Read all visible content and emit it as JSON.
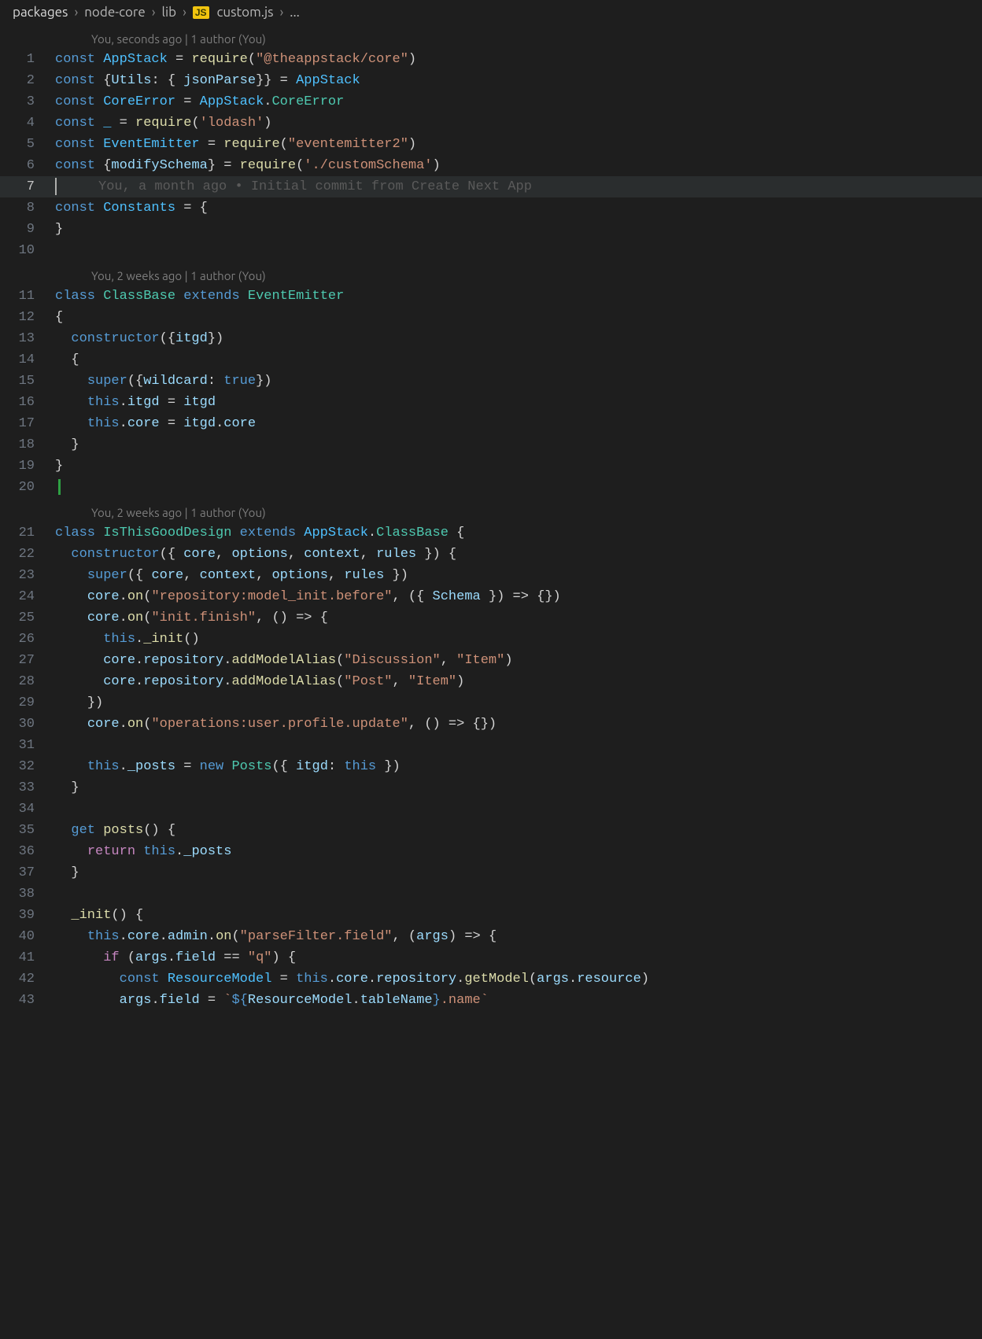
{
  "breadcrumb": {
    "seg1": "packages",
    "seg2": "node-core",
    "seg3": "lib",
    "seg4": "custom.js",
    "seg5": "...",
    "js_badge": "JS"
  },
  "codelens": {
    "block1": "You, seconds ago | 1 author (You)",
    "block2": "You, 2 weeks ago | 1 author (You)",
    "block3": "You, 2 weeks ago | 1 author (You)"
  },
  "blame": {
    "line7": "You, a month ago • Initial commit from Create Next App"
  },
  "line_numbers": [
    "1",
    "2",
    "3",
    "4",
    "5",
    "6",
    "7",
    "8",
    "9",
    "10",
    "11",
    "12",
    "13",
    "14",
    "15",
    "16",
    "17",
    "18",
    "19",
    "20",
    "21",
    "22",
    "23",
    "24",
    "25",
    "26",
    "27",
    "28",
    "29",
    "30",
    "31",
    "32",
    "33",
    "34",
    "35",
    "36",
    "37",
    "38",
    "39",
    "40",
    "41",
    "42",
    "43"
  ],
  "code": {
    "l1": {
      "a": "const",
      "b": "AppStack",
      "c": "=",
      "d": "require",
      "e": "(",
      "f": "\"@theappstack/core\"",
      "g": ")"
    },
    "l2": {
      "a": "const",
      "b": "{",
      "c": "Utils",
      "d": ": {",
      "e": "jsonParse",
      "f": "}} =",
      "g": "AppStack"
    },
    "l3": {
      "a": "const",
      "b": "CoreError",
      "c": "=",
      "d": "AppStack",
      "e": ".",
      "f": "CoreError"
    },
    "l4": {
      "a": "const",
      "b": "_",
      "c": "=",
      "d": "require",
      "e": "(",
      "f": "'lodash'",
      "g": ")"
    },
    "l5": {
      "a": "const",
      "b": "EventEmitter",
      "c": "=",
      "d": "require",
      "e": "(",
      "f": "\"eventemitter2\"",
      "g": ")"
    },
    "l6": {
      "a": "const",
      "b": "{",
      "c": "modifySchema",
      "d": "} =",
      "e": "require",
      "f": "(",
      "g": "'./customSchema'",
      "h": ")"
    },
    "l8": {
      "a": "const",
      "b": "Constants",
      "c": "= {"
    },
    "l9": {
      "a": "}"
    },
    "l11": {
      "a": "class",
      "b": "ClassBase",
      "c": "extends",
      "d": "EventEmitter"
    },
    "l12": {
      "a": "{"
    },
    "l13": {
      "a": "constructor",
      "b": "({",
      "c": "itgd",
      "d": "})"
    },
    "l14": {
      "a": "{"
    },
    "l15": {
      "a": "super",
      "b": "({",
      "c": "wildcard",
      "d": ":",
      "e": "true",
      "f": "})"
    },
    "l16": {
      "a": "this",
      "b": ".",
      "c": "itgd",
      "d": "=",
      "e": "itgd"
    },
    "l17": {
      "a": "this",
      "b": ".",
      "c": "core",
      "d": "=",
      "e": "itgd",
      "f": ".",
      "g": "core"
    },
    "l18": {
      "a": "}"
    },
    "l19": {
      "a": "}"
    },
    "l21": {
      "a": "class",
      "b": "IsThisGoodDesign",
      "c": "extends",
      "d": "AppStack",
      "e": ".",
      "f": "ClassBase",
      "g": "{"
    },
    "l22": {
      "a": "constructor",
      "b": "({",
      "c": "core",
      "d": ",",
      "e": "options",
      "f": ",",
      "g": "context",
      "h": ",",
      "i": "rules",
      "j": "}) {"
    },
    "l23": {
      "a": "super",
      "b": "({",
      "c": "core",
      "d": ",",
      "e": "context",
      "f": ",",
      "g": "options",
      "h": ",",
      "i": "rules",
      "j": "})"
    },
    "l24": {
      "a": "core",
      "b": ".",
      "c": "on",
      "d": "(",
      "e": "\"repository:model_init.before\"",
      "f": ", ({",
      "g": "Schema",
      "h": "}) => {})"
    },
    "l25": {
      "a": "core",
      "b": ".",
      "c": "on",
      "d": "(",
      "e": "\"init.finish\"",
      "f": ", () => {"
    },
    "l26": {
      "a": "this",
      "b": ".",
      "c": "_init",
      "d": "()"
    },
    "l27": {
      "a": "core",
      "b": ".",
      "c": "repository",
      "d": ".",
      "e": "addModelAlias",
      "f": "(",
      "g": "\"Discussion\"",
      "h": ",",
      "i": "\"Item\"",
      "j": ")"
    },
    "l28": {
      "a": "core",
      "b": ".",
      "c": "repository",
      "d": ".",
      "e": "addModelAlias",
      "f": "(",
      "g": "\"Post\"",
      "h": ",",
      "i": "\"Item\"",
      "j": ")"
    },
    "l29": {
      "a": "})"
    },
    "l30": {
      "a": "core",
      "b": ".",
      "c": "on",
      "d": "(",
      "e": "\"operations:user.profile.update\"",
      "f": ", () => {})"
    },
    "l32": {
      "a": "this",
      "b": ".",
      "c": "_posts",
      "d": "=",
      "e": "new",
      "f": "Posts",
      "g": "({",
      "h": "itgd",
      "i": ":",
      "j": "this",
      "k": "})"
    },
    "l33": {
      "a": "}"
    },
    "l35": {
      "a": "get",
      "b": "posts",
      "c": "() {"
    },
    "l36": {
      "a": "return",
      "b": "this",
      "c": ".",
      "d": "_posts"
    },
    "l37": {
      "a": "}"
    },
    "l39": {
      "a": "_init",
      "b": "() {"
    },
    "l40": {
      "a": "this",
      "b": ".",
      "c": "core",
      "d": ".",
      "e": "admin",
      "f": ".",
      "g": "on",
      "h": "(",
      "i": "\"parseFilter.field\"",
      "j": ", (",
      "k": "args",
      "l": ") => {"
    },
    "l41": {
      "a": "if",
      "b": "(",
      "c": "args",
      "d": ".",
      "e": "field",
      "f": "==",
      "g": "\"q\"",
      "h": ") {"
    },
    "l42": {
      "a": "const",
      "b": "ResourceModel",
      "c": "=",
      "d": "this",
      "e": ".",
      "f": "core",
      "g": ".",
      "h": "repository",
      "i": ".",
      "j": "getModel",
      "k": "(",
      "l": "args",
      "m": ".",
      "n": "resource",
      "o": ")"
    },
    "l43": {
      "a": "args",
      "b": ".",
      "c": "field",
      "d": "=",
      "e": "`",
      "f": "${",
      "g": "ResourceModel",
      "h": ".",
      "i": "tableName",
      "j": "}",
      "k": ".name",
      "l": "`"
    }
  }
}
